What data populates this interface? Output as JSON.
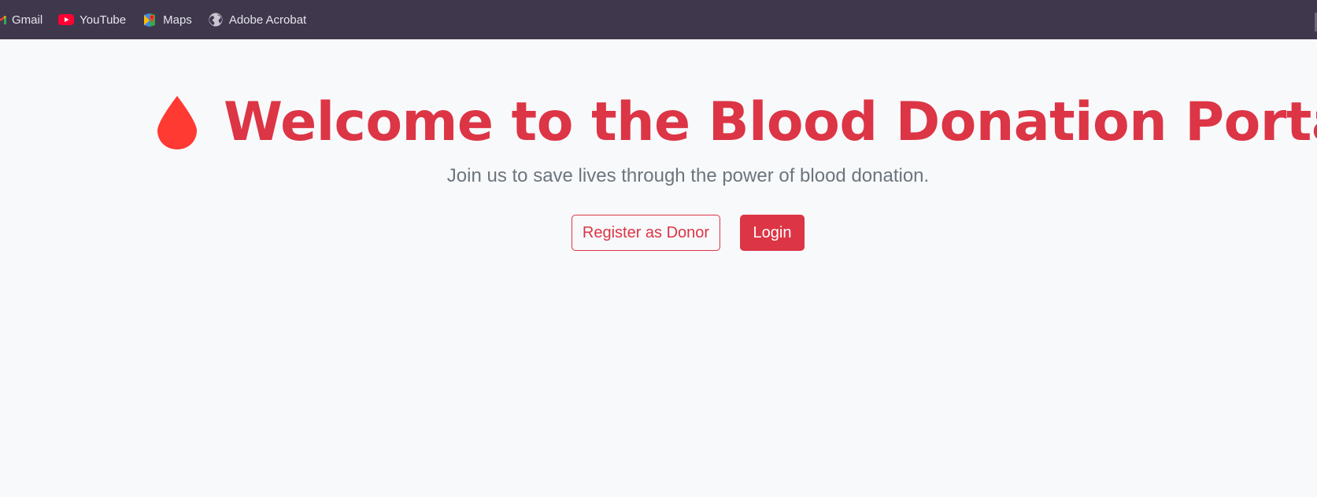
{
  "bookmarks": [
    {
      "label": "Gmail",
      "icon": "gmail-icon"
    },
    {
      "label": "YouTube",
      "icon": "youtube-icon"
    },
    {
      "label": "Maps",
      "icon": "maps-icon"
    },
    {
      "label": "Adobe Acrobat",
      "icon": "globe-icon"
    }
  ],
  "hero": {
    "icon": "blood-drop-icon",
    "title": "Welcome to the Blood Donation Portal",
    "subtitle": "Join us to save lives through the power of blood donation.",
    "register_label": "Register as Donor",
    "login_label": "Login"
  },
  "colors": {
    "toolbar_bg": "#3f384c",
    "page_bg": "#f8f9fb",
    "accent": "#dc3545",
    "drop": "#ff3a33",
    "muted_text": "#6c757d"
  }
}
